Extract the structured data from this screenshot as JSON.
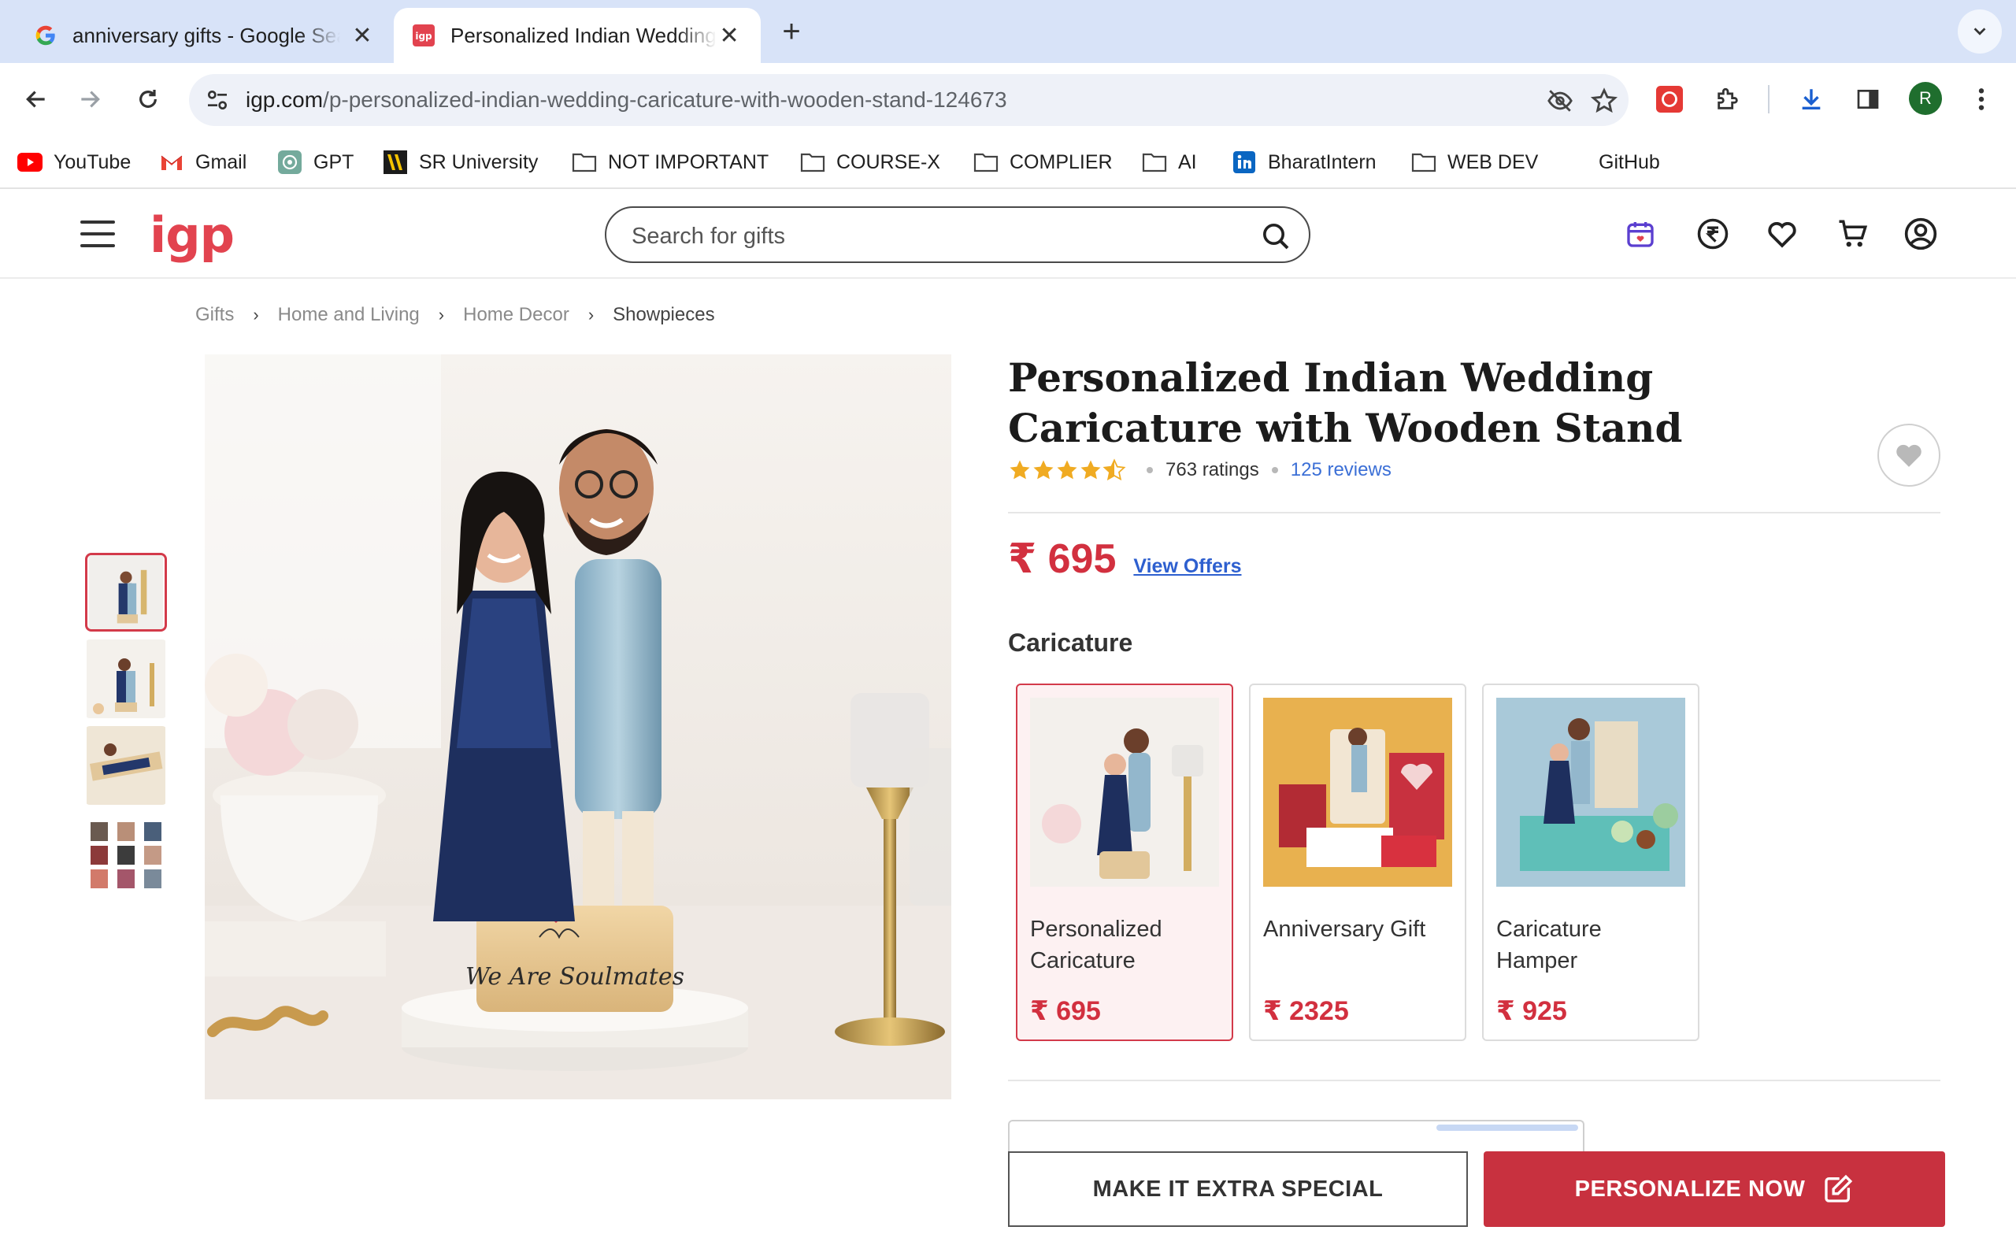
{
  "browser": {
    "tabs": [
      {
        "title": "anniversary gifts - Google Search",
        "active": false
      },
      {
        "title": "Personalized Indian Wedding Caricature",
        "active": true
      }
    ],
    "url_host": "igp.com",
    "url_path": "/p-personalized-indian-wedding-caricature-with-wooden-stand-124673",
    "profile_initial": "R"
  },
  "bookmarks": [
    {
      "label": "YouTube",
      "icon": "youtube-icon"
    },
    {
      "label": "Gmail",
      "icon": "gmail-icon"
    },
    {
      "label": "GPT",
      "icon": "gpt-icon"
    },
    {
      "label": "SR University",
      "icon": "sru-icon"
    },
    {
      "label": "NOT IMPORTANT",
      "icon": "folder-icon"
    },
    {
      "label": "COURSE-X",
      "icon": "folder-icon"
    },
    {
      "label": "COMPLIER",
      "icon": "folder-icon"
    },
    {
      "label": "AI",
      "icon": "folder-icon"
    },
    {
      "label": "BharatIntern",
      "icon": "linkedin-icon"
    },
    {
      "label": "WEB DEV",
      "icon": "folder-icon"
    },
    {
      "label": "GitHub",
      "icon": ""
    }
  ],
  "site": {
    "logo": "igp",
    "search_placeholder": "Search for gifts",
    "accent_color": "#e2434f"
  },
  "breadcrumb": [
    "Gifts",
    "Home and Living",
    "Home Decor",
    "Showpieces"
  ],
  "product": {
    "title": "Personalized Indian Wedding Caricature with Wooden Stand",
    "rating": 4.5,
    "ratings_count": "763 ratings",
    "reviews_link": "125 reviews",
    "price": "₹ 695",
    "view_offers": "View Offers",
    "plaque_text": "We Are Soulmates"
  },
  "variants": {
    "label": "Caricature",
    "items": [
      {
        "name": "Personalized Caricature",
        "price": "₹ 695",
        "selected": true
      },
      {
        "name": "Anniversary Gift",
        "price": "₹ 2325",
        "selected": false
      },
      {
        "name": "Caricature Hamper",
        "price": "₹ 925",
        "selected": false
      }
    ]
  },
  "actions": {
    "extra_special": "MAKE IT EXTRA SPECIAL",
    "personalize": "PERSONALIZE NOW"
  }
}
